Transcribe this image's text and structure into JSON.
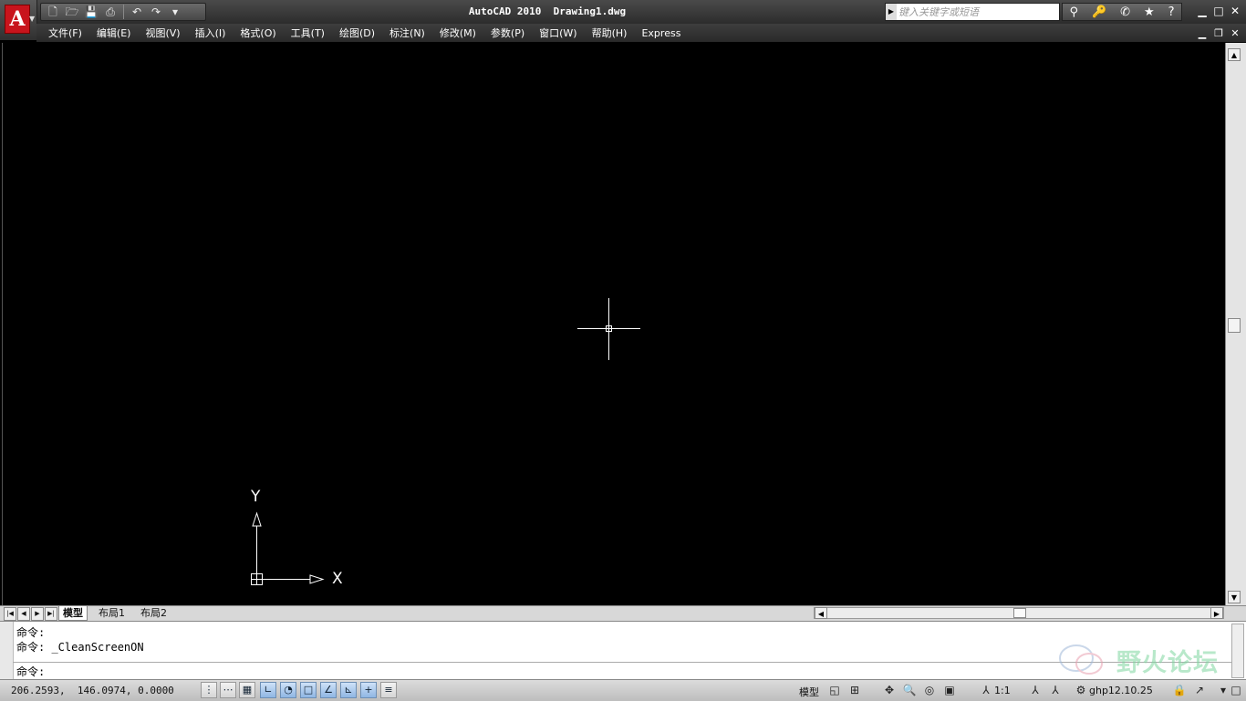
{
  "title": {
    "app_name": "AutoCAD 2010",
    "file_name": "Drawing1.dwg"
  },
  "qat": {
    "icons": [
      "new-icon",
      "open-icon",
      "save-icon",
      "plot-icon",
      "undo-icon",
      "redo-icon",
      "customize-icon"
    ]
  },
  "search": {
    "placeholder": "键入关键字或短语"
  },
  "menu": [
    "文件(F)",
    "编辑(E)",
    "视图(V)",
    "插入(I)",
    "格式(O)",
    "工具(T)",
    "绘图(D)",
    "标注(N)",
    "修改(M)",
    "参数(P)",
    "窗口(W)",
    "帮助(H)",
    "Express"
  ],
  "ucs": {
    "x_label": "X",
    "y_label": "Y"
  },
  "tabs": [
    "模型",
    "布局1",
    "布局2"
  ],
  "command": {
    "history": [
      "命令:",
      "命令: _CleanScreenON"
    ],
    "prompt": "命令:"
  },
  "watermark": {
    "text": "野火论坛"
  },
  "status": {
    "coordinates": "206.2593,  146.0974, 0.0000",
    "model_label": "模型",
    "scale": "1:1",
    "workspace": "ghp12.10.25"
  },
  "colors": {
    "canvas_bg": "#000000",
    "crosshair": "#ffffff",
    "toggle_on": "#8fb6e3"
  }
}
